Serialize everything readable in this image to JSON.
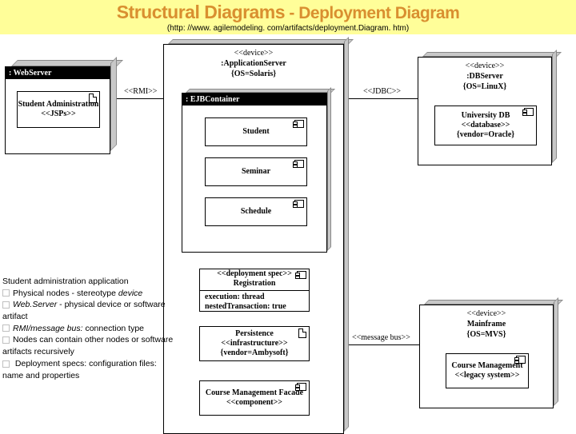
{
  "title_main": "Structural Diagrams",
  "title_sep": " - ",
  "title_sub": "Deployment Diagram",
  "subtitle": "(http: //www. agilemodeling. com/artifacts/deployment.Diagram. htm)",
  "nodes": {
    "webserver": {
      "header": ": WebServer",
      "artifact": "Student Administration <<JSPs>>"
    },
    "appserver": {
      "stereo": "<<device>>",
      "name": ":ApplicationServer",
      "tag": "{OS=Solaris}",
      "container": ": EJBContainer",
      "artifacts": [
        "Student",
        "Seminar",
        "Schedule"
      ],
      "depspec": {
        "stereo": "<<deployment spec>>",
        "name": "Registration",
        "p1": "execution: thread",
        "p2": "nestedTransaction: true"
      },
      "infra": {
        "name": "Persistence",
        "stereo": "<<infrastructure>>",
        "tag": "{vendor=Ambysoft}"
      },
      "facade": {
        "name": "Course Management Facade",
        "stereo": "<<component>>"
      }
    },
    "dbserver": {
      "stereo": "<<device>>",
      "name": ":DBServer",
      "tag": "{OS=LinuX}",
      "db": {
        "name": "University DB",
        "stereo": "<<database>>",
        "tag": "{vendor=Oracle}"
      }
    },
    "mainframe": {
      "stereo": "<<device>>",
      "name": "Mainframe",
      "tag": "{OS=MVS}",
      "course": {
        "name": "Course Management",
        "stereo": "<<legacy system>>"
      }
    }
  },
  "connectors": {
    "rmi": "<<RMI>>",
    "jdbc": "<<JDBC>>",
    "msgbus": "<<message bus>>"
  },
  "notes": {
    "heading": "Student administration application",
    "b1a": "Physical nodes - stereotype ",
    "b1b": "device",
    "b2a": "Web.Server",
    "b2b": " - physical device or software artifact",
    "b3a": "RMI/message bus:",
    "b3b": " connection type",
    "b4": "Nodes can contain other nodes or software artifacts recursively",
    "b5": " Deployment specs: configuration files: name and properties"
  }
}
